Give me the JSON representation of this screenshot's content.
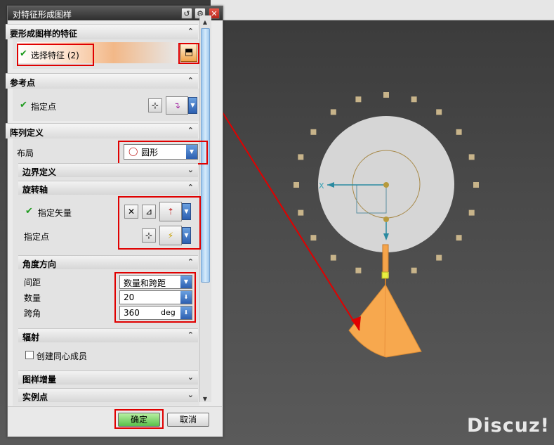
{
  "window": {
    "title": "对特征形成图样"
  },
  "titlebar_buttons": {
    "reset_icon": "reset-icon",
    "settings_icon": "gear-icon",
    "close_icon": "close-icon"
  },
  "sections": {
    "features": {
      "title": "要形成图样的特征",
      "select_label": "选择特征 (2)"
    },
    "reference_point": {
      "title": "参考点",
      "specify_point": "指定点"
    },
    "array_definition": {
      "title": "阵列定义",
      "layout_label": "布局",
      "layout_value": "圆形",
      "boundary_definition": "边界定义",
      "rotation_axis": {
        "title": "旋转轴",
        "specify_vector": "指定矢量",
        "specify_point": "指定点"
      },
      "angular_direction": {
        "title": "角度方向",
        "spacing_label": "间距",
        "spacing_value": "数量和跨距",
        "count_label": "数量",
        "count_value": "20",
        "span_label": "跨角",
        "span_value": "360",
        "span_unit": "deg"
      },
      "radiate": {
        "title": "辐射",
        "concentric_label": "创建同心成员",
        "concentric_checked": false
      },
      "pattern_increment": "图样增量",
      "instance_points": "实例点"
    }
  },
  "footer": {
    "ok_label": "确定",
    "cancel_label": "取消"
  },
  "viewport": {
    "axis_label": "X",
    "watermark": "Discuz!"
  },
  "colors": {
    "highlight_red": "#e00000",
    "feature_orange": "#f5a44a",
    "ok_green": "#59c04a"
  }
}
